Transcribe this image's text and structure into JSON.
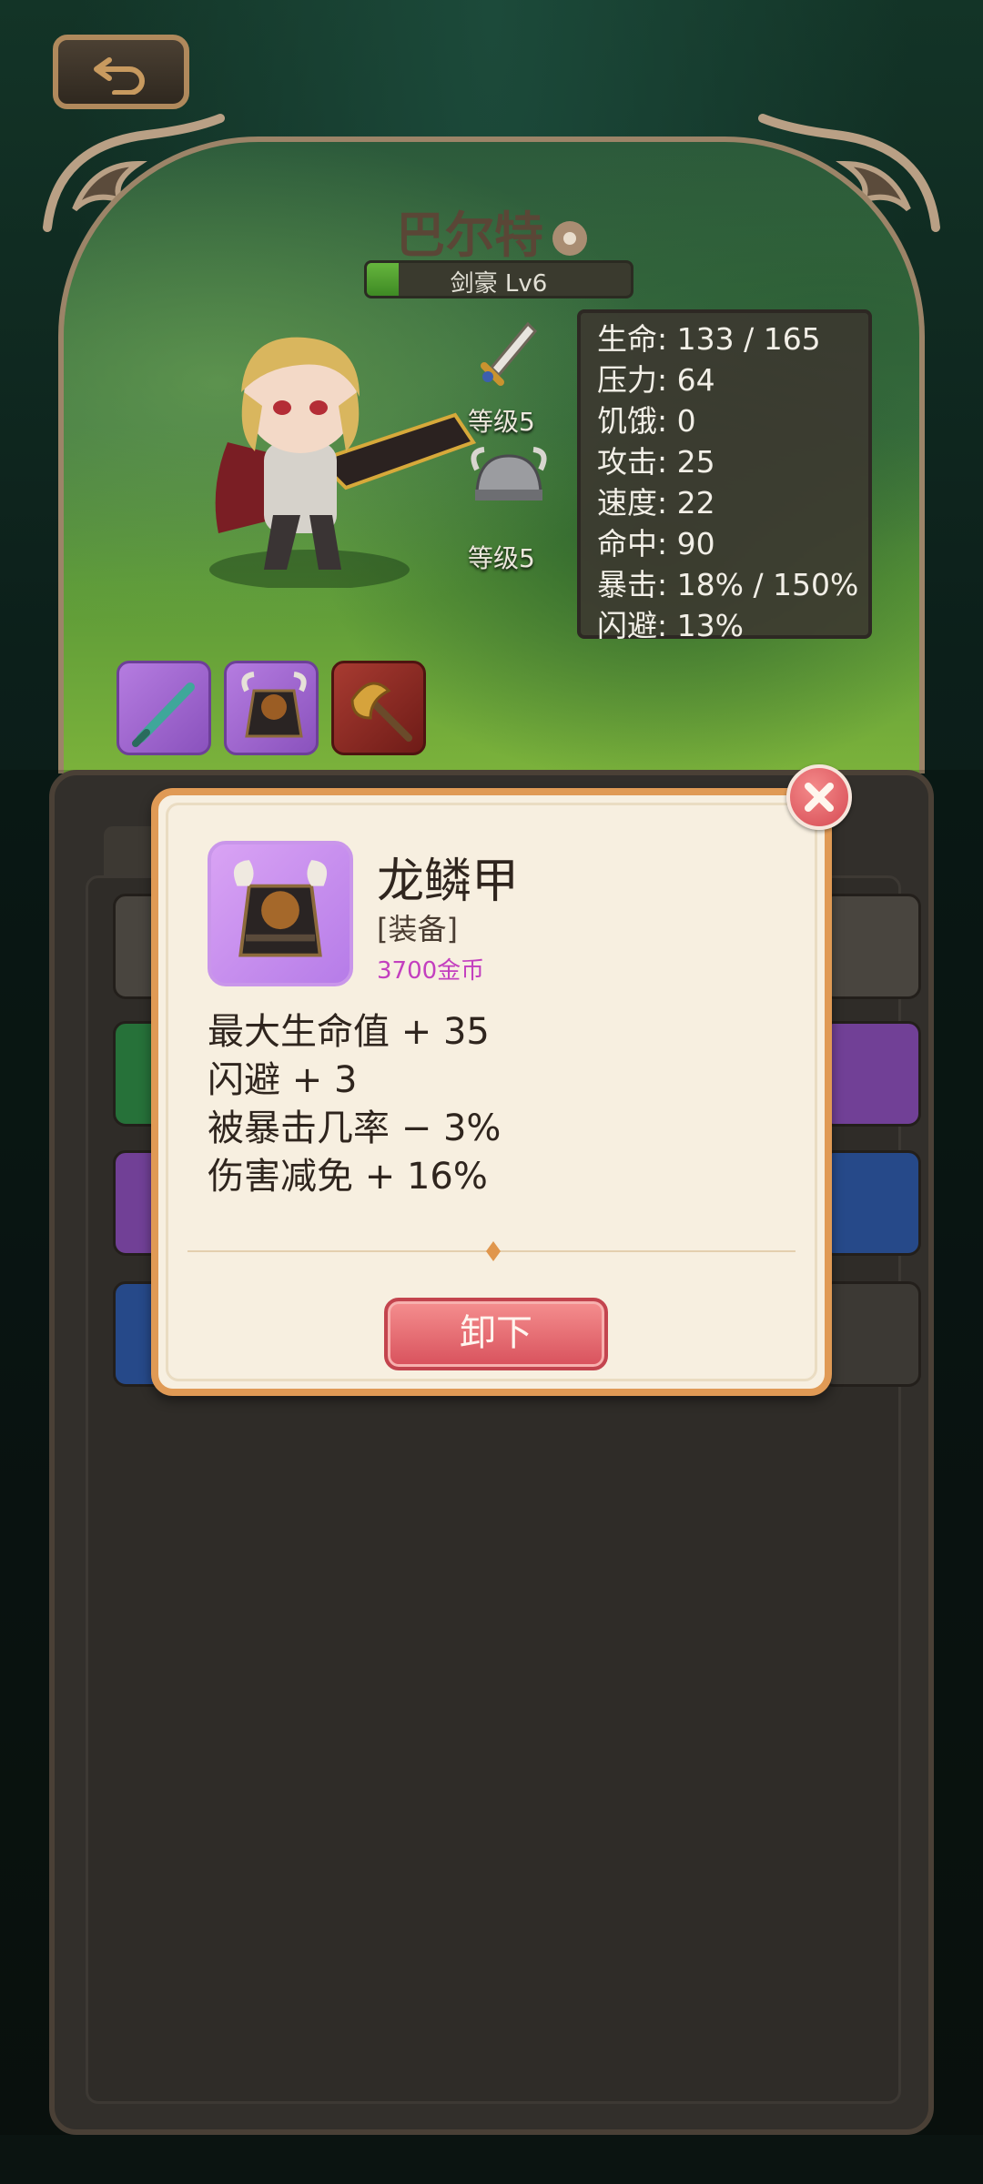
{
  "hero": {
    "name": "巴尔特",
    "class_level": "剑豪 Lv6",
    "class_progress": 0.12,
    "weapon_level": "等级5",
    "helmet_level": "等级5"
  },
  "stats": [
    "生命: 133 / 165",
    "压力: 64",
    "饥饿: 0",
    "攻击: 25",
    "速度: 22",
    "命中: 90",
    "暴击: 18% / 150%",
    "闪避: 13%"
  ],
  "equipped_slots": [
    {
      "icon": "sword-icon",
      "color": "#a86bd6"
    },
    {
      "icon": "armor-icon",
      "color": "#a86bd6"
    },
    {
      "icon": "axe-icon",
      "color": "#8e2a24"
    }
  ],
  "popup": {
    "item_name": "龙鳞甲",
    "item_type": "[装备]",
    "price": "3700金币",
    "effects": [
      "最大生命值 + 35",
      "闪避 + 3",
      "被暴击几率 − 3%",
      "伤害减免 + 16%"
    ],
    "unequip_label": "卸下"
  },
  "colors": {
    "accent": "#e09a55",
    "price": "#c33fbf",
    "button": "#d8515c"
  }
}
